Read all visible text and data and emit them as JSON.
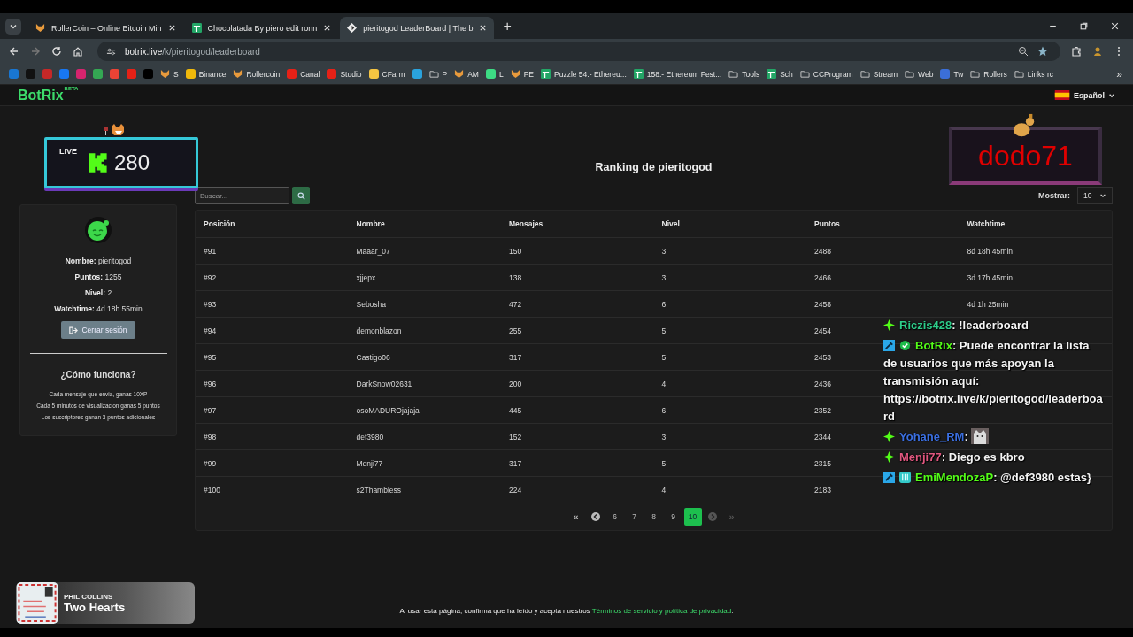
{
  "browser": {
    "tabs": [
      {
        "title": "RollerCoin – Online Bitcoin Min",
        "kind": "fox",
        "selected": false
      },
      {
        "title": "Chocolatada By piero edit ronn",
        "kind": "sheet",
        "selected": false
      },
      {
        "title": "pieritogod LeaderBoard | The b",
        "kind": "diamond",
        "selected": true
      }
    ],
    "new_tab": "+",
    "address": {
      "host": "botrix.live",
      "path": "/k/pieritogod/leaderboard"
    },
    "bookmarks": [
      {
        "kind": "site",
        "color": "#1976d2"
      },
      {
        "kind": "site",
        "color": "#111111"
      },
      {
        "kind": "site",
        "color": "#c62828"
      },
      {
        "kind": "site",
        "color": "#1877f2"
      },
      {
        "kind": "site",
        "color": "#d6246e"
      },
      {
        "kind": "site",
        "color": "#34a853"
      },
      {
        "kind": "site",
        "color": "#ea4335"
      },
      {
        "kind": "site",
        "color": "#e62117"
      },
      {
        "kind": "site",
        "color": "#000000"
      },
      {
        "kind": "fox",
        "label": "S"
      },
      {
        "kind": "site",
        "color": "#f0b90b",
        "label": "Binance"
      },
      {
        "kind": "fox",
        "label": "Rollercoin"
      },
      {
        "kind": "site",
        "color": "#e62117",
        "label": "Canal"
      },
      {
        "kind": "site",
        "color": "#e62117",
        "label": "Studio"
      },
      {
        "kind": "site",
        "color": "#f5c542",
        "label": "CFarm"
      },
      {
        "kind": "site",
        "color": "#2aa3dd"
      },
      {
        "kind": "folder",
        "label": "P"
      },
      {
        "kind": "fox",
        "label": "AM"
      },
      {
        "kind": "site",
        "color": "#3ddc84",
        "label": "L"
      },
      {
        "kind": "fox",
        "label": "PE"
      },
      {
        "kind": "sheet",
        "label": "Puzzle 54.- Ethereu..."
      },
      {
        "kind": "sheet",
        "label": "158.- Ethereum Fest..."
      },
      {
        "kind": "folder",
        "label": "Tools"
      },
      {
        "kind": "sheet",
        "label": "Sch"
      },
      {
        "kind": "folder",
        "label": "CCProgram"
      },
      {
        "kind": "folder",
        "label": "Stream"
      },
      {
        "kind": "folder",
        "label": "Web"
      },
      {
        "kind": "site",
        "color": "#3b6fd8",
        "label": "Tw"
      },
      {
        "kind": "folder",
        "label": "Rollers"
      },
      {
        "kind": "folder",
        "label": "Links rc"
      }
    ],
    "more": "»"
  },
  "header": {
    "logo": "BotRix",
    "beta": "BETA",
    "language": "Español"
  },
  "live_widget": {
    "label": "LIVE",
    "count": "280"
  },
  "alert_widget": {
    "name": "dodo71"
  },
  "profile": {
    "fields": [
      {
        "label": "Nombre:",
        "value": "pieritogod"
      },
      {
        "label": "Puntos:",
        "value": "1255"
      },
      {
        "label": "Nivel:",
        "value": "2"
      },
      {
        "label": "Watchtime:",
        "value": "4d 18h 55min"
      }
    ],
    "logout": "Cerrar sesión",
    "how_title": "¿Cómo funciona?",
    "how_lines": [
      "Cada mensaje que envia, ganas 10XP",
      "Cada 5 minutos de visualizacion ganas 5 puntos",
      "Los suscriptores ganan 3 puntos adicionales"
    ]
  },
  "ranking": {
    "title": "Ranking de pieritogod",
    "search": {
      "placeholder": "Buscar..."
    },
    "show_label": "Mostrar:",
    "show_value": "10",
    "columns": [
      "Posición",
      "Nombre",
      "Mensajes",
      "Nivel",
      "Puntos",
      "Watchtime"
    ],
    "rows": [
      {
        "cells": [
          "#91",
          "Maaar_07",
          "150",
          "3",
          "2488",
          "8d 18h 45min"
        ]
      },
      {
        "cells": [
          "#92",
          "xjjepx",
          "138",
          "3",
          "2466",
          "3d 17h 45min"
        ]
      },
      {
        "cells": [
          "#93",
          "Sebosha",
          "472",
          "6",
          "2458",
          "4d 1h 25min"
        ]
      },
      {
        "cells": [
          "#94",
          "demonblazon",
          "255",
          "5",
          "2454"
        ]
      },
      {
        "cells": [
          "#95",
          "Castigo06",
          "317",
          "5",
          "2453"
        ]
      },
      {
        "cells": [
          "#96",
          "DarkSnow02631",
          "200",
          "4",
          "2436"
        ]
      },
      {
        "cells": [
          "#97",
          "osoMADUROjajaja",
          "445",
          "6",
          "2352"
        ]
      },
      {
        "cells": [
          "#98",
          "def3980",
          "152",
          "3",
          "2344"
        ]
      },
      {
        "cells": [
          "#99",
          "Menji77",
          "317",
          "5",
          "2315"
        ]
      },
      {
        "cells": [
          "#100",
          "s2Thambless",
          "224",
          "4",
          "2183"
        ]
      }
    ],
    "pagination": {
      "first": {
        "label": "«",
        "disabled": false
      },
      "prev": {
        "disabled": false
      },
      "pages": [
        {
          "label": "6",
          "selected": false
        },
        {
          "label": "7",
          "selected": false
        },
        {
          "label": "8",
          "selected": false
        },
        {
          "label": "9",
          "selected": false
        },
        {
          "label": "10",
          "selected": true
        }
      ],
      "next": {
        "disabled": true
      },
      "last": {
        "label": "»",
        "disabled": true
      }
    }
  },
  "chat": [
    {
      "kind": "text",
      "badges": [
        {
          "kind": "sparkle"
        }
      ],
      "user": "Riczis428",
      "color": "#2ecc8a",
      "text": ": !leaderboard"
    },
    {
      "kind": "text",
      "badges": [
        {
          "kind": "mod"
        },
        {
          "kind": "verified"
        }
      ],
      "user": "BotRix",
      "color": "#53fc18",
      "text": ": Puede encontrar la lista de usuarios que más apoyan la transmisión aquí: https://botrix.live/k/pieritogod/leaderboard"
    },
    {
      "kind": "emote",
      "badges": [
        {
          "kind": "sparkle"
        }
      ],
      "user": "Yohane_RM",
      "color": "#3b6fe0",
      "text": ":"
    },
    {
      "kind": "text",
      "badges": [
        {
          "kind": "sparkle"
        }
      ],
      "user": "Menji77",
      "color": "#e0577f",
      "text": ": Diego es kbro"
    },
    {
      "kind": "text",
      "badges": [
        {
          "kind": "mod"
        },
        {
          "kind": "sub"
        }
      ],
      "user": "EmiMendozaP",
      "color": "#53fc18",
      "text": ": @def3980 estas}"
    }
  ],
  "now_playing": {
    "artist": "PHIL COLLINS",
    "title": "Two Hearts"
  },
  "footer": {
    "text": "Al usar esta página, confirma que ha leído y acepta nuestros",
    "link": "Términos de servicio y política de privacidad",
    "end": "."
  }
}
